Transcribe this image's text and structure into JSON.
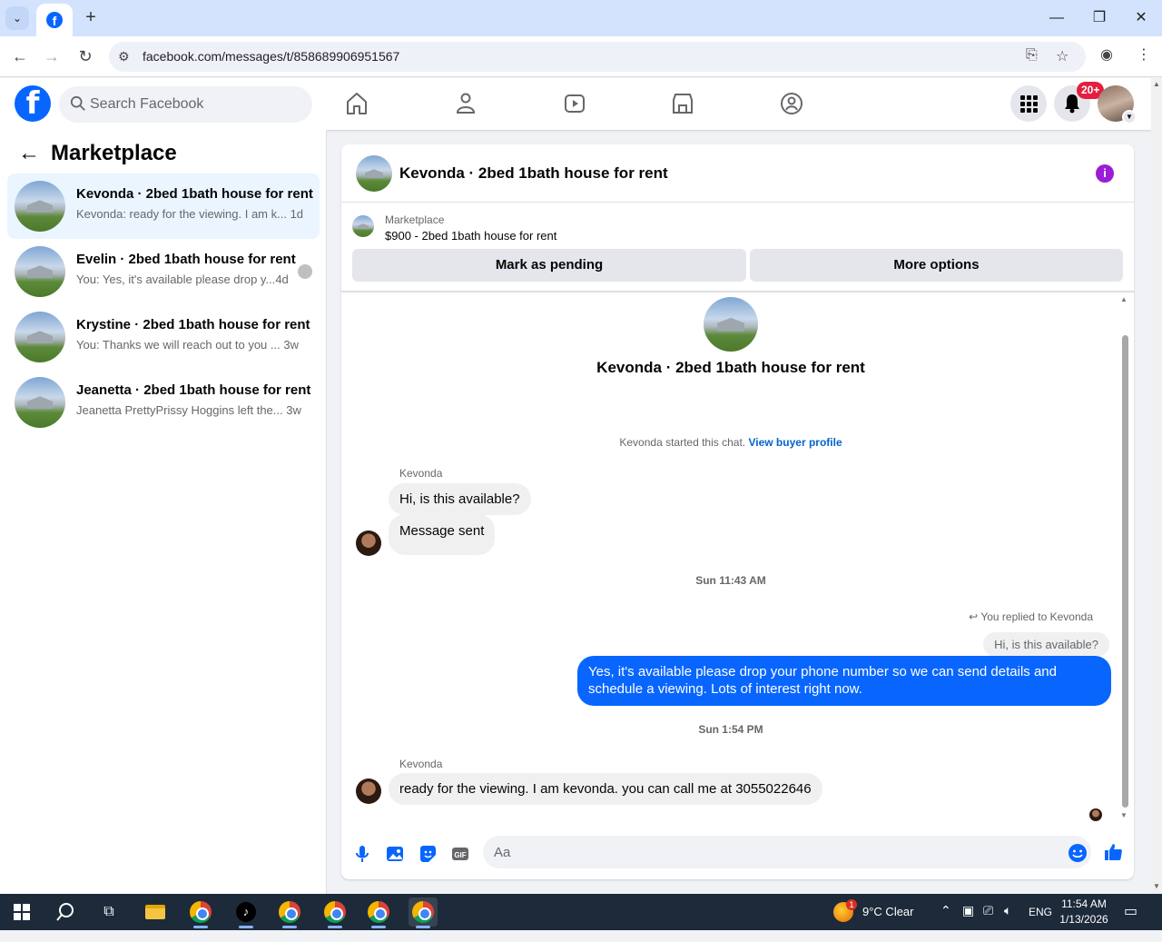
{
  "browser": {
    "tab_title_icon": "facebook-favicon",
    "url": "facebook.com/messages/t/858689906951567"
  },
  "fb_header": {
    "search_placeholder": "Search Facebook",
    "notification_count": "20+",
    "nav_icons": [
      "home-icon",
      "friends-icon",
      "video-icon",
      "marketplace-icon",
      "groups-icon"
    ]
  },
  "sidebar": {
    "title": "Marketplace",
    "conversations": [
      {
        "name": "Kevonda · 2bed 1bath house for rent",
        "snippet": "Kevonda: ready for the viewing. I am k...",
        "time": "1d",
        "active": true
      },
      {
        "name": "Evelin · 2bed 1bath house for rent",
        "snippet": "You: Yes, it's available please drop y...",
        "time": "4d",
        "active": false
      },
      {
        "name": "Krystine · 2bed 1bath house for rent",
        "snippet": "You: Thanks we will reach out to you ...",
        "time": "3w",
        "active": false
      },
      {
        "name": "Jeanetta · 2bed 1bath house for rent",
        "snippet": "Jeanetta PrettyPrissy Hoggins left the...",
        "time": "3w",
        "active": false
      }
    ]
  },
  "chat": {
    "title": "Kevonda · 2bed 1bath house for rent",
    "listing": {
      "label": "Marketplace",
      "price_title": "$900 - 2bed 1bath house for rent"
    },
    "buttons": {
      "mark_pending": "Mark as pending",
      "more_options": "More options"
    },
    "intro_name": "Kevonda · 2bed 1bath house for rent",
    "started_text": "Kevonda started this chat.",
    "view_profile": "View buyer profile",
    "messages": {
      "sender1": "Kevonda",
      "msg1": "Hi, is this available?",
      "msg2": "Message sent",
      "ts1": "Sun 11:43 AM",
      "replied_label": "You replied to Kevonda",
      "quoted": "Hi, is this available?",
      "reply": "Yes, it's available please drop your phone number so we can send details and schedule a viewing. Lots of interest right now.",
      "ts2": "Sun 1:54 PM",
      "sender2": "Kevonda",
      "msg3": "ready for the viewing. I am kevonda. you  can call me at 3055022646"
    },
    "composer_placeholder": "Aa"
  },
  "taskbar": {
    "weather": "9°C  Clear",
    "lang": "ENG",
    "time": "11:54 AM",
    "date": "1/13/2026",
    "weather_badge": "1"
  },
  "colors": {
    "fb_blue": "#0866ff",
    "link": "#0064d1",
    "active_conv": "#ebf5ff",
    "badge_red": "#e41e3f"
  }
}
